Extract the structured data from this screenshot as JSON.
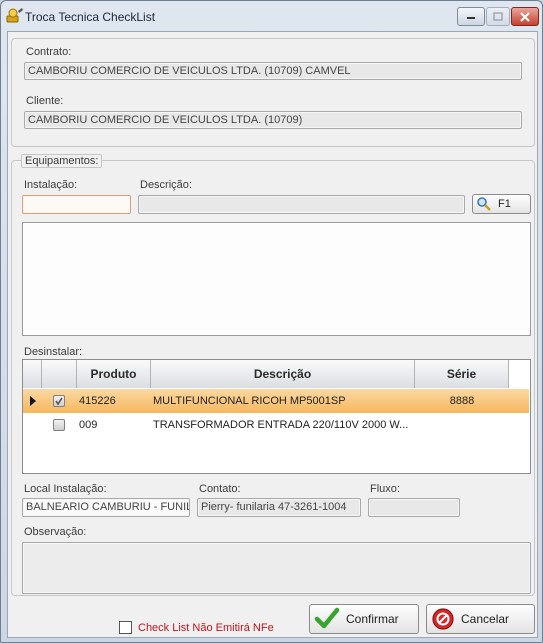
{
  "window": {
    "title": "Troca Tecnica CheckList"
  },
  "header": {
    "contrato_label": "Contrato:",
    "contrato_value": "CAMBORIU COMERCIO DE VEICULOS LTDA. (10709) CAMVEL",
    "cliente_label": "Cliente:",
    "cliente_value": "CAMBORIU COMERCIO DE VEICULOS LTDA. (10709)"
  },
  "equipamentos": {
    "legend": "Equipamentos:",
    "instalacao_label": "Instalação:",
    "instalacao_value": "",
    "descricao_label": "Descrição:",
    "descricao_value": "",
    "search_button_label": "F1",
    "desinstalar_label": "Desinstalar:",
    "columns": [
      "Produto",
      "Descrição",
      "Série"
    ],
    "rows": [
      {
        "checked": true,
        "produto": "415226",
        "descricao": "MULTIFUNCIONAL RICOH MP5001SP",
        "serie": "8888",
        "selected": true
      },
      {
        "checked": false,
        "produto": "009",
        "descricao": "TRANSFORMADOR ENTRADA 220/110V 2000 W...",
        "serie": "",
        "selected": false
      }
    ],
    "local_label": "Local Instalação:",
    "local_value": "BALNEARIO CAMBURIU - FUNIL",
    "contato_label": "Contato:",
    "contato_value": "Pierry- funilaria 47-3261-1004",
    "fluxo_label": "Fluxo:",
    "fluxo_value": "",
    "observacao_label": "Observação:",
    "observacao_value": ""
  },
  "footer": {
    "checkbox_label": "Check List Não Emitirá NFe",
    "confirm_label": "Confirmar",
    "cancel_label": "Cancelar"
  },
  "colors": {
    "selected_row": "#f6b75e",
    "warning_text": "#c0141d",
    "confirm_icon": "#3aa52e",
    "cancel_icon": "#cc1f1f"
  }
}
